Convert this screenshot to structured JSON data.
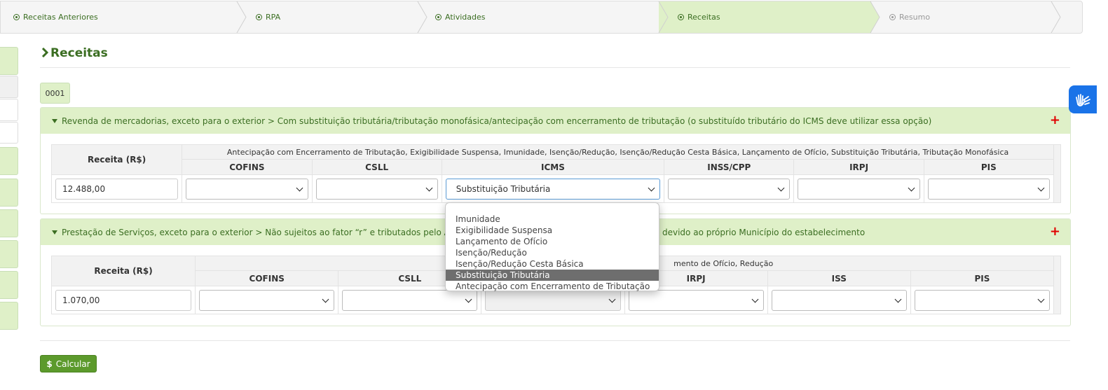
{
  "wizard": {
    "steps": [
      {
        "label": "Receitas Anteriores",
        "state": "done"
      },
      {
        "label": "RPA",
        "state": "done"
      },
      {
        "label": "Atividades",
        "state": "done"
      },
      {
        "label": "Receitas",
        "state": "active"
      },
      {
        "label": "Resumo",
        "state": "pending"
      }
    ]
  },
  "page": {
    "title": "Receitas",
    "doc_tab": "0001"
  },
  "panels": [
    {
      "title": "Revenda de mercadorias, exceto para o exterior > Com substituição tributária/tributação monofásica/antecipação com encerramento de tributação (o substituído tributário do ICMS deve utilizar essa opção)",
      "add": "+",
      "receita_header": "Receita (R$)",
      "group_header": "Antecipação com Encerramento de Tributação, Exigibilidade Suspensa, Imunidade, Isenção/Redução, Isenção/Redução Cesta Básica, Lançamento de Ofício, Substituição Tributária, Tributação Monofásica",
      "columns": [
        "COFINS",
        "CSLL",
        "ICMS",
        "INSS/CPP",
        "IRPJ",
        "PIS"
      ],
      "receita_value": "12.488,00",
      "selected": [
        "",
        "",
        "Substituição Tributária",
        "",
        "",
        ""
      ]
    },
    {
      "title_left": "Prestação de Serviços, exceto para o exterior > Não sujeitos ao fator “r” e tributados pelo Anexo III",
      "title_right": "devido ao próprio Município do estabelecimento",
      "add": "+",
      "receita_header": "Receita (R$)",
      "group_header_visible": "mento de Ofício, Redução",
      "columns": [
        "COFINS",
        "CSLL",
        "",
        "IRPJ",
        "ISS",
        "PIS"
      ],
      "receita_value": "1.070,00",
      "selected": [
        "",
        "",
        "",
        "",
        "",
        ""
      ]
    }
  ],
  "dropdown": {
    "options": [
      "",
      "Imunidade",
      "Exigibilidade Suspensa",
      "Lançamento de Ofício",
      "Isenção/Redução",
      "Isenção/Redução Cesta Básica",
      "Substituição Tributária",
      "Antecipação com Encerramento de Tributação"
    ],
    "selected": "Substituição Tributária"
  },
  "actions": {
    "calculate_icon": "$",
    "calculate_label": "Calcular"
  },
  "colors": {
    "brand_green": "#3b6e22",
    "light_green": "#dff0c8",
    "button_green": "#5c9a2c",
    "add_red": "#e00000",
    "a11y_blue": "#1a73e8"
  }
}
